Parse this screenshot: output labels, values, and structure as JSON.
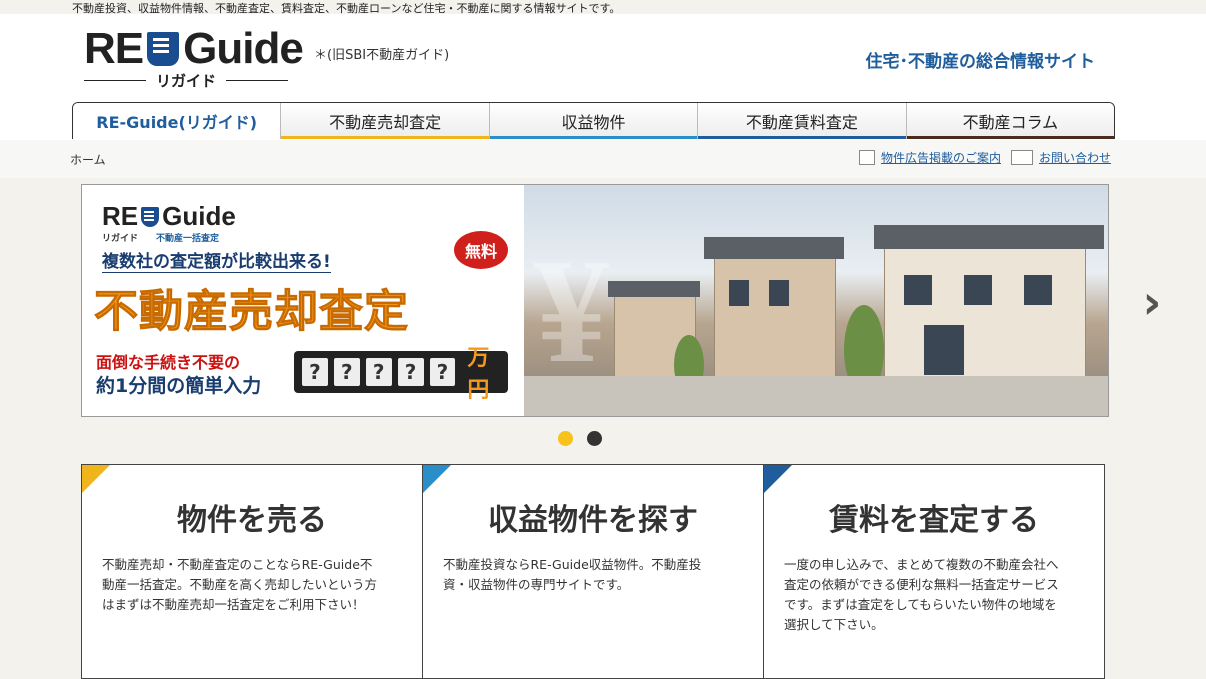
{
  "top_notice": "不動産投資、収益物件情報、不動産査定、賃料査定、不動産ローンなど住宅・不動産に関する情報サイトです。",
  "logo": {
    "text": "RE Guide",
    "sub": "リガイド",
    "note": "＊(旧SBI不動産ガイド)"
  },
  "tagline": "住宅･不動産の総合情報サイト",
  "nav": [
    {
      "label": "RE-Guide(リガイド)",
      "accent": ""
    },
    {
      "label": "不動産売却査定",
      "accent": "#f0b51c"
    },
    {
      "label": "収益物件",
      "accent": "#2a8fc9"
    },
    {
      "label": "不動産賃料査定",
      "accent": "#1f5d9c"
    },
    {
      "label": "不動産コラム",
      "accent": "#4a2c1a"
    }
  ],
  "breadcrumb": "ホーム",
  "header_links": {
    "ad": "物件広告掲載のご案内",
    "contact": "お問い合わせ"
  },
  "banner": {
    "logo": "RE Guide",
    "logo_sub": "リガイド",
    "logo_sub2": "不動産一括査定",
    "compare": "複数社の査定額が比較出来る!",
    "free": "無料",
    "headline": "不動産売却査定",
    "easy1": "面倒な手続き不要の",
    "easy2": "約1分間の簡単入力",
    "meter": [
      "?",
      "?",
      "?",
      "?",
      "?"
    ],
    "unit": "万円"
  },
  "carousel": {
    "slides": 2,
    "active": 1
  },
  "cards": [
    {
      "title": "物件を売る",
      "corner": "#f0b51c",
      "text": "不動産売却・不動産査定のことならRE-Guide不動産一括査定。不動産を高く売却したいという方はまずは不動産売却一括査定をご利用下さい！"
    },
    {
      "title": "収益物件を探す",
      "corner": "#2a8fc9",
      "text": "不動産投資ならRE-Guide収益物件。不動産投資・収益物件の専門サイトです。"
    },
    {
      "title": "賃料を査定する",
      "corner": "#1f5d9c",
      "text": "一度の申し込みで、まとめて複数の不動産会社へ査定の依頼ができる便利な無料一括査定サービスです。まずは査定をしてもらいたい物件の地域を選択して下さい。"
    }
  ]
}
